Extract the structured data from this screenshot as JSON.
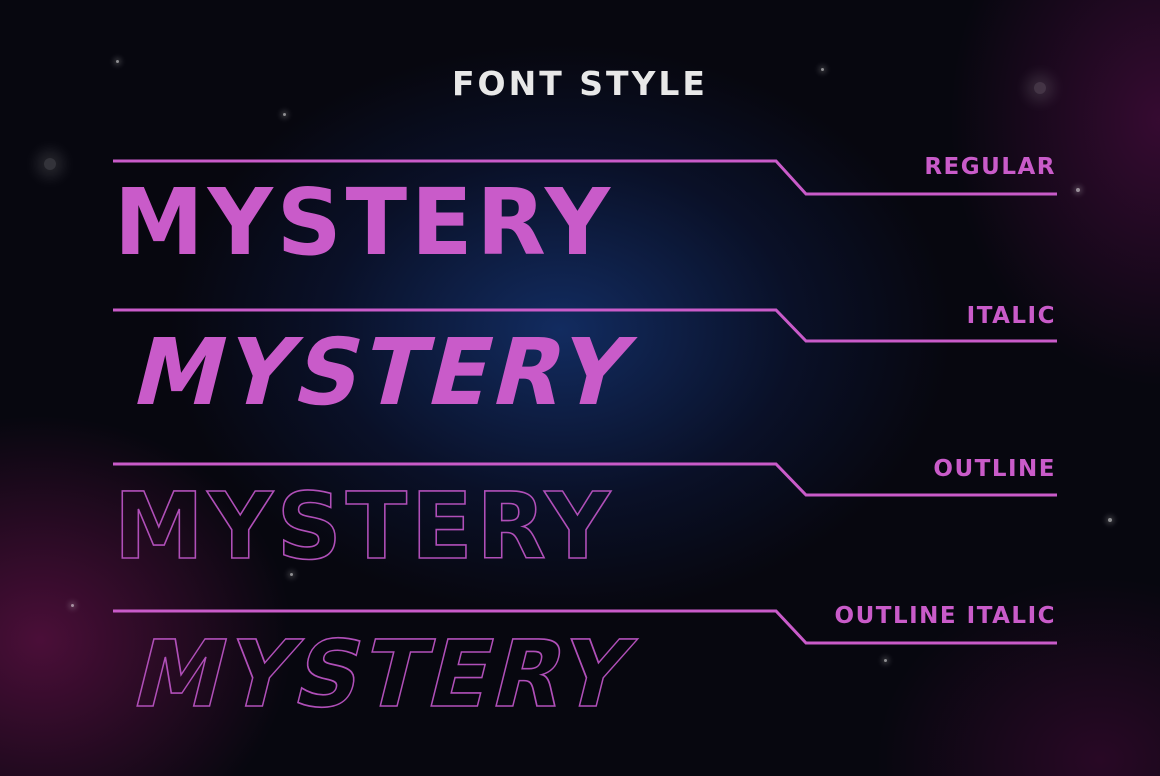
{
  "title": "FONT STYLE",
  "accent_color": "#c95bc9",
  "rows": [
    {
      "label": "REGULAR",
      "sample": "MYSTERY",
      "style": "filled"
    },
    {
      "label": "ITALIC",
      "sample": "MYSTERY",
      "style": "filled-italic"
    },
    {
      "label": "OUTLINE",
      "sample": "MYSTERY",
      "style": "outline"
    },
    {
      "label": "OUTLINE ITALIC",
      "sample": "MYSTERY",
      "style": "outline-italic"
    }
  ]
}
